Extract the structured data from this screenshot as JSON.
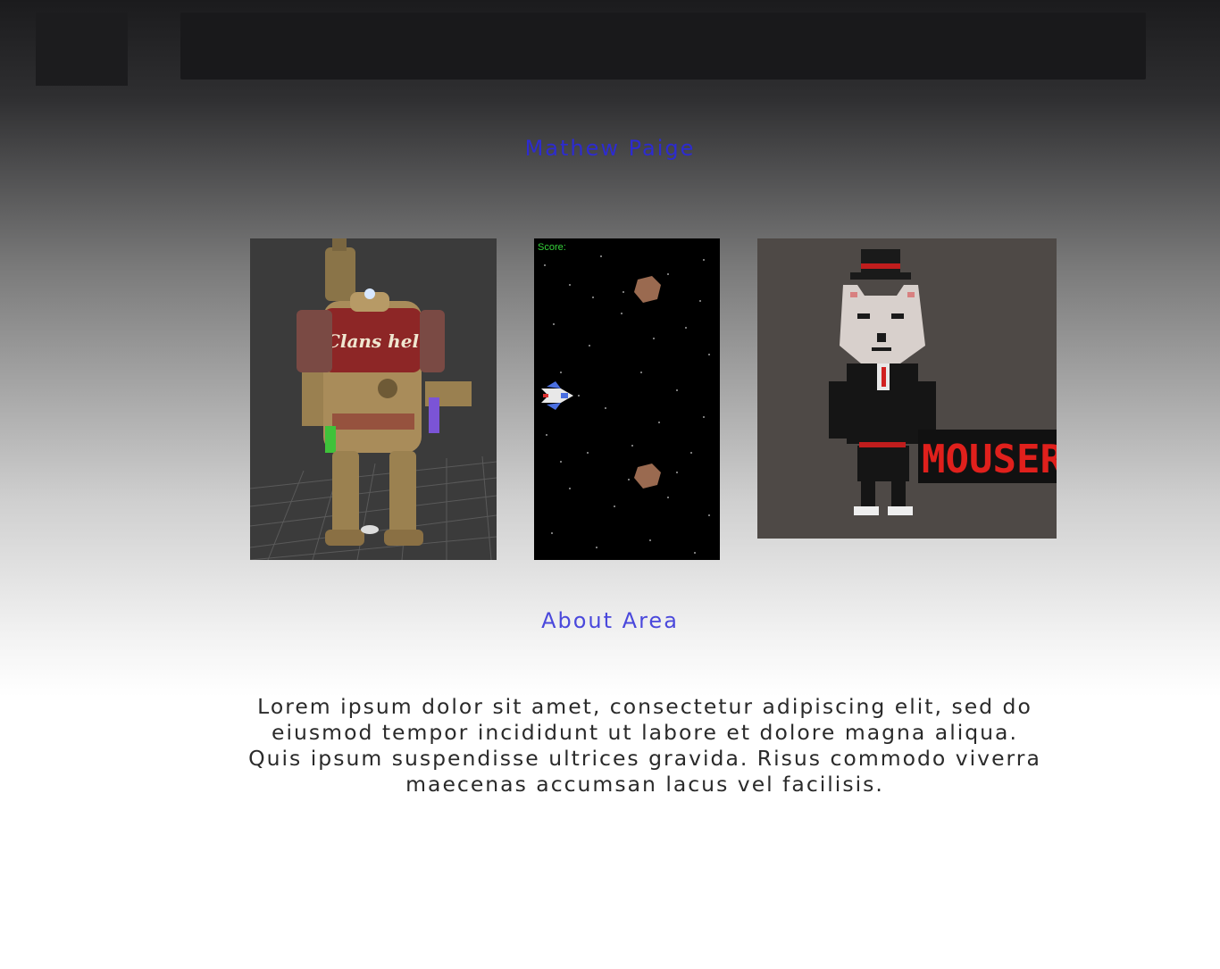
{
  "header": {
    "logo_icon": "logo-placeholder",
    "nav": "navigation-bar"
  },
  "site": {
    "title": "Mathew Paige",
    "title_color": "#2d2bd0"
  },
  "gallery": {
    "items": [
      {
        "name": "robot-3d-model",
        "icon": "robot-render-thumbnail",
        "text": "Clans hel"
      },
      {
        "name": "space-shooter-game",
        "icon": "space-shooter-thumbnail",
        "score_label": "Score:"
      },
      {
        "name": "mouser-pixel-art",
        "icon": "pixel-cat-thumbnail",
        "text": "MOUSER"
      }
    ]
  },
  "about": {
    "title": "About Area",
    "body": "Lorem ipsum dolor sit amet, consectetur adipiscing elit, sed do eiusmod tempor incididunt ut labore et dolore magna aliqua. Quis ipsum suspendisse ultrices gravida. Risus commodo viverra maecenas accumsan lacus vel facilisis."
  }
}
